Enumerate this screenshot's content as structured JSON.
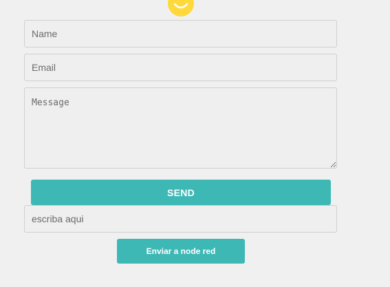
{
  "form": {
    "name": {
      "value": "",
      "placeholder": "Name"
    },
    "email": {
      "value": "",
      "placeholder": "Email"
    },
    "message": {
      "value": "",
      "placeholder": "Message"
    },
    "send_label": "SEND"
  },
  "node_red": {
    "input": {
      "value": "",
      "placeholder": "escriba aqui"
    },
    "button_label": "Enviar a node red"
  },
  "icons": {
    "top": "smiley-face-icon"
  },
  "colors": {
    "page_background": "#f0f0f0",
    "accent": "#3db8b5",
    "smiley": "#ffd93b"
  }
}
